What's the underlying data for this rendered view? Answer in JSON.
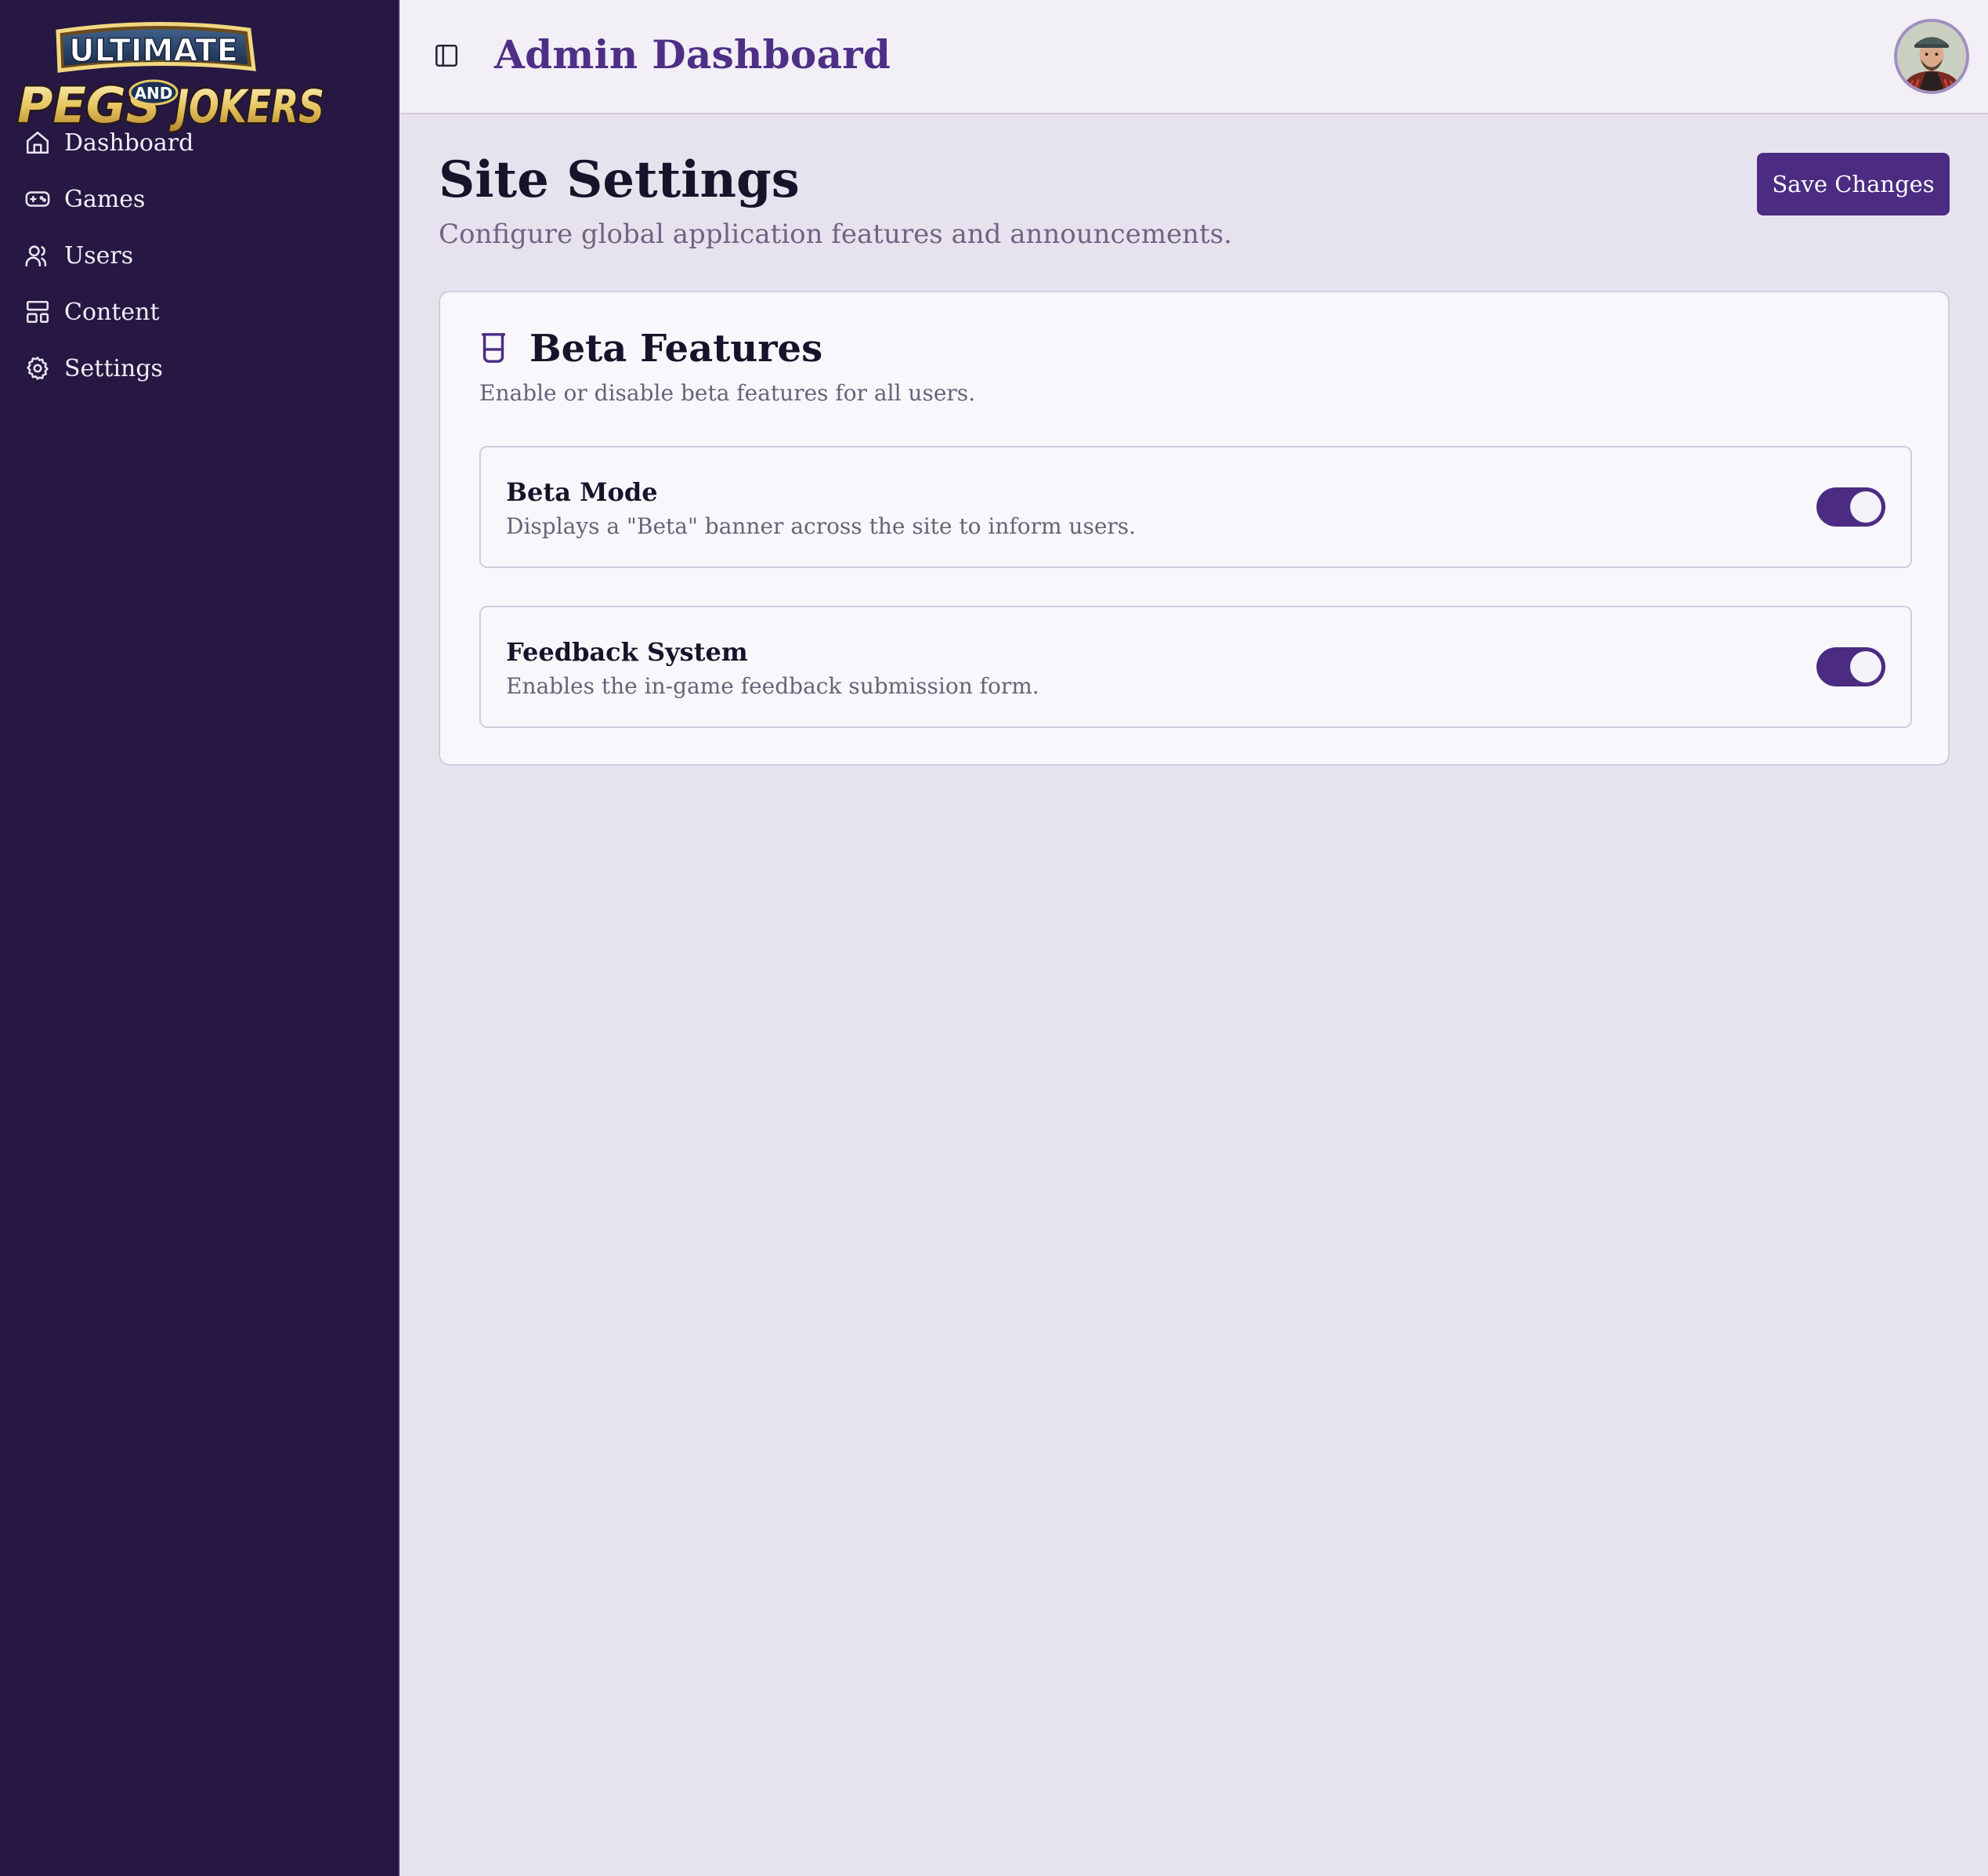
{
  "brand": {
    "logo_text_top": "ULTIMATE",
    "logo_text_left": "PEGS",
    "logo_text_mid": "AND",
    "logo_text_right": "JOKERS"
  },
  "sidebar": {
    "items": [
      {
        "label": "Dashboard",
        "icon": "home-icon"
      },
      {
        "label": "Games",
        "icon": "gamepad-icon"
      },
      {
        "label": "Users",
        "icon": "users-icon"
      },
      {
        "label": "Content",
        "icon": "layout-icon"
      },
      {
        "label": "Settings",
        "icon": "gear-icon"
      }
    ]
  },
  "header": {
    "title": "Admin Dashboard",
    "toggle_icon": "panel-left-icon",
    "avatar": "user-avatar"
  },
  "main": {
    "title": "Site Settings",
    "subtitle": "Configure global application features and announcements.",
    "save_label": "Save Changes"
  },
  "beta_card": {
    "icon": "beaker-icon",
    "title": "Beta Features",
    "subtitle": "Enable or disable beta features for all users.",
    "settings": [
      {
        "label": "Beta Mode",
        "description": "Displays a \"Beta\" banner across the site to inform users.",
        "enabled": true
      },
      {
        "label": "Feedback System",
        "description": "Enables the in-game feedback submission form.",
        "enabled": true
      }
    ]
  },
  "colors": {
    "sidebar_bg": "#261842",
    "accent": "#4b2c82",
    "title_purple": "#4e2f86",
    "page_bg": "#e7e3ee"
  }
}
